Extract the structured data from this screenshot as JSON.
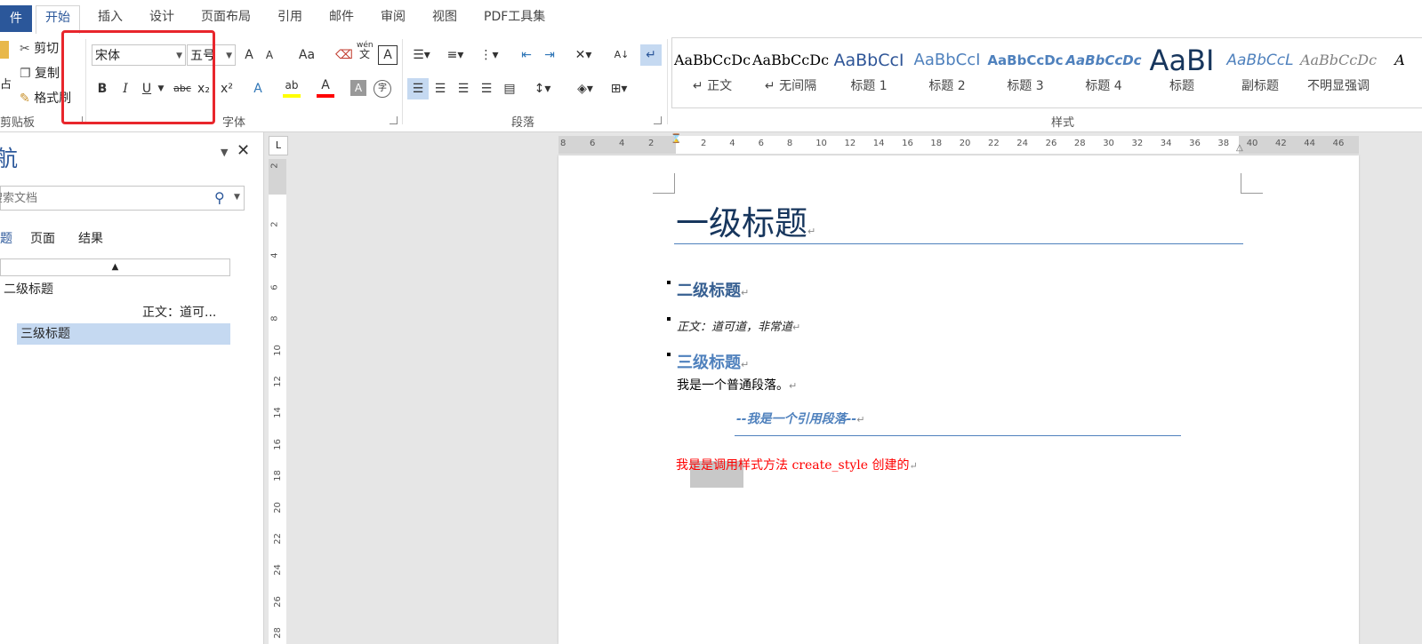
{
  "tabs": [
    "件",
    "开始",
    "插入",
    "设计",
    "页面布局",
    "引用",
    "邮件",
    "审阅",
    "视图",
    "PDF工具集"
  ],
  "clipboard": {
    "cut": "剪切",
    "copy": "复制",
    "painter": "格式刷",
    "paste_partial": "占",
    "group_label": "剪贴板"
  },
  "font": {
    "name": "宋体",
    "size": "五号",
    "group_label": "字体",
    "bold": "B",
    "italic": "I",
    "underline": "U",
    "strike": "abc",
    "sub": "x₂",
    "sup": "x²",
    "grow": "A",
    "shrink": "A",
    "case": "Aa",
    "phonetic_top": "wén",
    "phonetic_bottom": "文",
    "border_char": "A",
    "effects": "A",
    "highlight": "ab",
    "color": "A",
    "shading": "A",
    "enclose": "字"
  },
  "paragraph": {
    "group_label": "段落",
    "sort": "A↓"
  },
  "styles": {
    "group_label": "样式",
    "items": [
      {
        "sample": "AaBbCcDc",
        "name": "↵ 正文"
      },
      {
        "sample": "AaBbCcDc",
        "name": "↵ 无间隔"
      },
      {
        "sample": "AaBbCcI",
        "name": "标题 1"
      },
      {
        "sample": "AaBbCcI",
        "name": "标题 2"
      },
      {
        "sample": "AaBbCcDc",
        "name": "标题 3"
      },
      {
        "sample": "AaBbCcDc",
        "name": "标题 4"
      },
      {
        "sample": "AaBI",
        "name": "标题"
      },
      {
        "sample": "AaBbCcL",
        "name": "副标题"
      },
      {
        "sample": "AaBbCcDc",
        "name": "不明显强调"
      },
      {
        "sample": "A",
        "name": ""
      }
    ]
  },
  "nav": {
    "title": "导航",
    "search_placeholder": "搜索文档",
    "tabs": [
      "标题",
      "页面",
      "结果"
    ],
    "tree": [
      {
        "label": "二级标题"
      },
      {
        "label": "正文：道可..."
      },
      {
        "label": "三级标题"
      }
    ]
  },
  "ruler": {
    "h_ticks": [
      "8",
      "6",
      "4",
      "2",
      "2",
      "4",
      "6",
      "8",
      "10",
      "12",
      "14",
      "16",
      "18",
      "20",
      "22",
      "24",
      "26",
      "28",
      "30",
      "32",
      "34",
      "36",
      "38",
      "40",
      "42",
      "44",
      "46"
    ],
    "v_ticks": [
      "2",
      "2",
      "4",
      "6",
      "8",
      "10",
      "12",
      "14",
      "16",
      "18",
      "20",
      "22",
      "24",
      "26",
      "28"
    ],
    "corner": "L"
  },
  "doc": {
    "h1": "一级标题",
    "h2": "二级标题",
    "body_italic": "正文：道可道，非常道",
    "h3": "三级标题",
    "para": "我是一个普通段落。",
    "quote": "--我是一个引用段落--",
    "custom": "我是是调用样式方法 create_style 创建的",
    "mark": "↵"
  },
  "colors": {
    "accent": "#2b579a",
    "highlight_box": "#e8262c",
    "heading": "#17365d",
    "h2": "#365f91",
    "h3": "#4f81bd",
    "red": "#ff0000"
  }
}
